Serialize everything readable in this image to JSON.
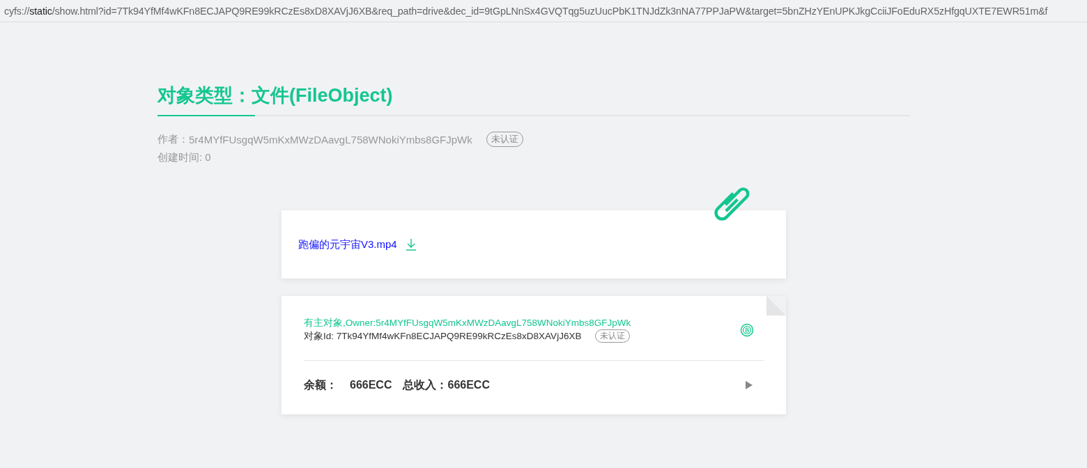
{
  "address_bar": {
    "scheme": "cyfs://",
    "host": "static",
    "path": "/show.html?id=7Tk94YfMf4wKFn8ECJAPQ9RE99kRCzEs8xD8XAVjJ6XB&req_path=drive&dec_id=9tGpLNnSx4GVQTqg5uzUucPbK1TNJdZk3nNA77PPJaPW&target=5bnZHzYEnUPKJkgCciiJFoEduRX5zHfgqUXTE7EWR51m&f"
  },
  "heading": {
    "title": "对象类型：文件(FileObject)"
  },
  "meta": {
    "author_label": "作者：",
    "author": "5r4MYfFUsgqW5mKxMWzDAavgL758WNokiYmbs8GFJpWk",
    "author_badge": "未认证",
    "created": "创建时间: 0"
  },
  "file_card": {
    "file_name": "跑偏的元宇宙V3.mp4"
  },
  "owner_card": {
    "owner_line": "有主对象,Owner:5r4MYfFUsgqW5mKxMWzDAavgL758WNokiYmbs8GFJpWk",
    "object_id": "对象Id: 7Tk94YfMf4wKFn8ECJAPQ9RE99kRCzEs8xD8XAVjJ6XB",
    "id_badge": "未认证",
    "balance_label": "余额：",
    "balance": "666ECC",
    "income_label": "总收入：",
    "income": "666ECC"
  }
}
